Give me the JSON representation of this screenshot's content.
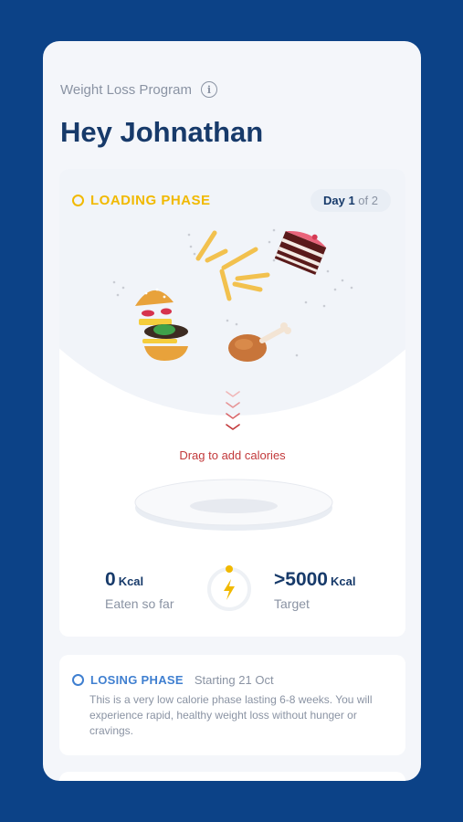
{
  "header": {
    "program_label": "Weight Loss Program",
    "greeting": "Hey Johnathan"
  },
  "loading_phase": {
    "label": "LOADING PHASE",
    "day_prefix": "Day",
    "day_current": "1",
    "day_separator": "of",
    "day_total": "2",
    "drag_hint": "Drag to add calories",
    "eaten_value": "0",
    "eaten_unit": "Kcal",
    "eaten_caption": "Eaten so far",
    "target_value": ">5000",
    "target_unit": "Kcal",
    "target_caption": "Target",
    "progress": 0
  },
  "losing_phase": {
    "label": "LOSING PHASE",
    "start": "Starting 21 Oct",
    "description": "This is a very low calorie phase lasting 6-8 weeks. You will experience rapid, healthy weight loss without hunger or cravings."
  },
  "icons": {
    "info": "info-icon",
    "gauge": "lightning-icon",
    "burger": "burger-icon",
    "fries": "fries-icon",
    "cake": "cake-icon",
    "chicken": "chicken-leg-icon",
    "chevrons": "chevron-down-icon",
    "plate": "plate-icon"
  },
  "colors": {
    "background": "#0c4287",
    "title": "#173a6a",
    "loading_accent": "#f1b900",
    "losing_accent": "#3f7fd0",
    "drag_hint": "#c2393b",
    "muted": "#8a93a3"
  }
}
